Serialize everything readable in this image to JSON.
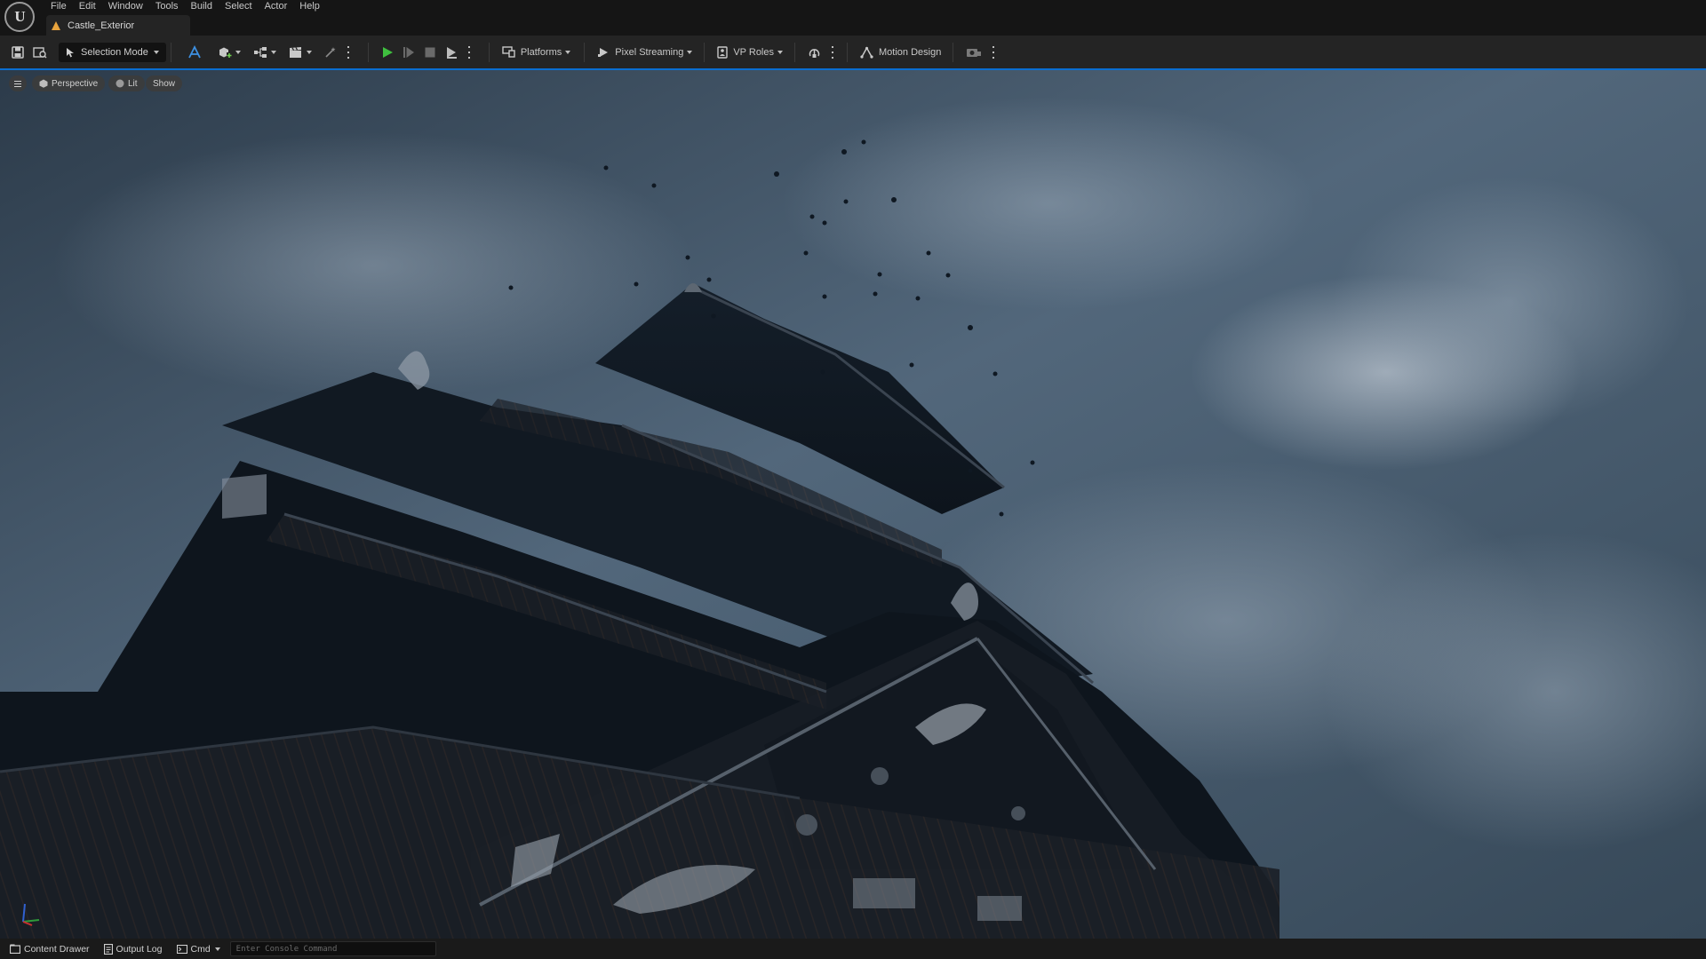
{
  "app": {
    "logo_text": "U"
  },
  "menu": [
    "File",
    "Edit",
    "Window",
    "Tools",
    "Build",
    "Select",
    "Actor",
    "Help"
  ],
  "document_tab": {
    "label": "Castle_Exterior",
    "status_icon": "warning-icon"
  },
  "toolbar": {
    "selection_mode": "Selection Mode",
    "platforms": "Platforms",
    "pixel_streaming": "Pixel Streaming",
    "vp_roles": "VP Roles",
    "motion_design": "Motion Design",
    "play_color": "#3fbf3f"
  },
  "viewport": {
    "perspective": "Perspective",
    "lit": "Lit",
    "show": "Show",
    "selection_outline_color": "#0a6ed1"
  },
  "statusbar": {
    "content_drawer": "Content Drawer",
    "output_log": "Output Log",
    "cmd": "Cmd",
    "console_placeholder": "Enter Console Command"
  }
}
